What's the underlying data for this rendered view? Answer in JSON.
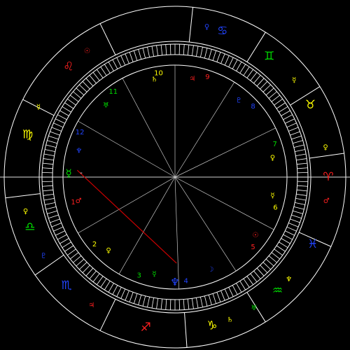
{
  "chart": {
    "colors": {
      "background": "#000000",
      "ring_line": "#ffffff",
      "cusp_line": "#c8c8c8",
      "axis_line": "#e0e0e0",
      "aspect_line": "#cc0000",
      "fire": "#ff2020",
      "earth": "#ffff00",
      "air": "#00dd00",
      "water": "#2244ff",
      "house_number": "#ffff00"
    },
    "signs": [
      {
        "name": "Cancer",
        "glyph": "♋",
        "color": "#2244ff",
        "ruler": {
          "glyph": "♀",
          "color": "#2244ff"
        }
      },
      {
        "name": "Gemini",
        "glyph": "♊",
        "color": "#00dd00",
        "ruler": {
          "glyph": "☿",
          "color": "#ffff00"
        }
      },
      {
        "name": "Taurus",
        "glyph": "♉",
        "color": "#ffff00",
        "ruler": {
          "glyph": "♀",
          "color": "#ffff00"
        }
      },
      {
        "name": "Aries",
        "glyph": "♈",
        "color": "#ff2020",
        "ruler": {
          "glyph": "♂",
          "color": "#ff2020"
        }
      },
      {
        "name": "Pisces",
        "glyph": "♓",
        "color": "#2244ff",
        "ruler": {
          "glyph": "♆",
          "color": "#ffff00"
        }
      },
      {
        "name": "Aquarius",
        "glyph": "♒",
        "color": "#00dd00",
        "ruler": {
          "glyph": "♅",
          "color": "#00dd00"
        }
      },
      {
        "name": "Capricorn",
        "glyph": "♑",
        "color": "#ffff00",
        "ruler": {
          "glyph": "♄",
          "color": "#ffff00"
        }
      },
      {
        "name": "Sagittarius",
        "glyph": "♐",
        "color": "#ff2020",
        "ruler": {
          "glyph": "♃",
          "color": "#ff2020"
        }
      },
      {
        "name": "Scorpio",
        "glyph": "♏",
        "color": "#2244ff",
        "ruler": {
          "glyph": "♇",
          "color": "#2244ff"
        }
      },
      {
        "name": "Libra",
        "glyph": "♎",
        "color": "#00dd00",
        "ruler": {
          "glyph": "♀",
          "color": "#ffff00"
        }
      },
      {
        "name": "Virgo",
        "glyph": "♍",
        "color": "#ffff00",
        "ruler": {
          "glyph": "☿",
          "color": "#ffff00"
        }
      },
      {
        "name": "Leo",
        "glyph": "♌",
        "color": "#ff2020",
        "ruler": {
          "glyph": "☉",
          "color": "#ff2020"
        }
      }
    ],
    "houses": [
      {
        "number": "1",
        "color": "#ff2020",
        "ruler": {
          "glyph": "♂",
          "color": "#ff2020"
        }
      },
      {
        "number": "2",
        "color": "#ffff00",
        "ruler": {
          "glyph": "♀",
          "color": "#ffff00"
        }
      },
      {
        "number": "3",
        "color": "#00dd00",
        "ruler": {
          "glyph": "☿",
          "color": "#00dd00"
        }
      },
      {
        "number": "4",
        "color": "#2244ff",
        "ruler": {
          "glyph": "☽",
          "color": "#2244ff"
        }
      },
      {
        "number": "5",
        "color": "#ff2020",
        "ruler": {
          "glyph": "☉",
          "color": "#ff2020"
        }
      },
      {
        "number": "6",
        "color": "#ffff00",
        "ruler": {
          "glyph": "☿",
          "color": "#ffff00"
        }
      },
      {
        "number": "7",
        "color": "#00dd00",
        "ruler": {
          "glyph": "♀",
          "color": "#ffff00"
        }
      },
      {
        "number": "8",
        "color": "#2244ff",
        "ruler": {
          "glyph": "♇",
          "color": "#2244ff"
        }
      },
      {
        "number": "9",
        "color": "#ff2020",
        "ruler": {
          "glyph": "♃",
          "color": "#ff2020"
        }
      },
      {
        "number": "10",
        "color": "#ffff00",
        "ruler": {
          "glyph": "♄",
          "color": "#ffff00"
        }
      },
      {
        "number": "11",
        "color": "#00dd00",
        "ruler": {
          "glyph": "♅",
          "color": "#00dd00"
        }
      },
      {
        "number": "12",
        "color": "#2244ff",
        "ruler": {
          "glyph": "♆",
          "color": "#2244ff"
        }
      }
    ],
    "planets": [
      {
        "name": "Mercury",
        "glyph": "☿",
        "color": "#00dd00",
        "label": "-"
      },
      {
        "name": "Neptune",
        "glyph": "♆",
        "color": "#2244ff",
        "label": ""
      }
    ],
    "aspects": [
      {
        "from": "Mercury",
        "to": "Neptune",
        "color": "#cc0000"
      }
    ]
  }
}
